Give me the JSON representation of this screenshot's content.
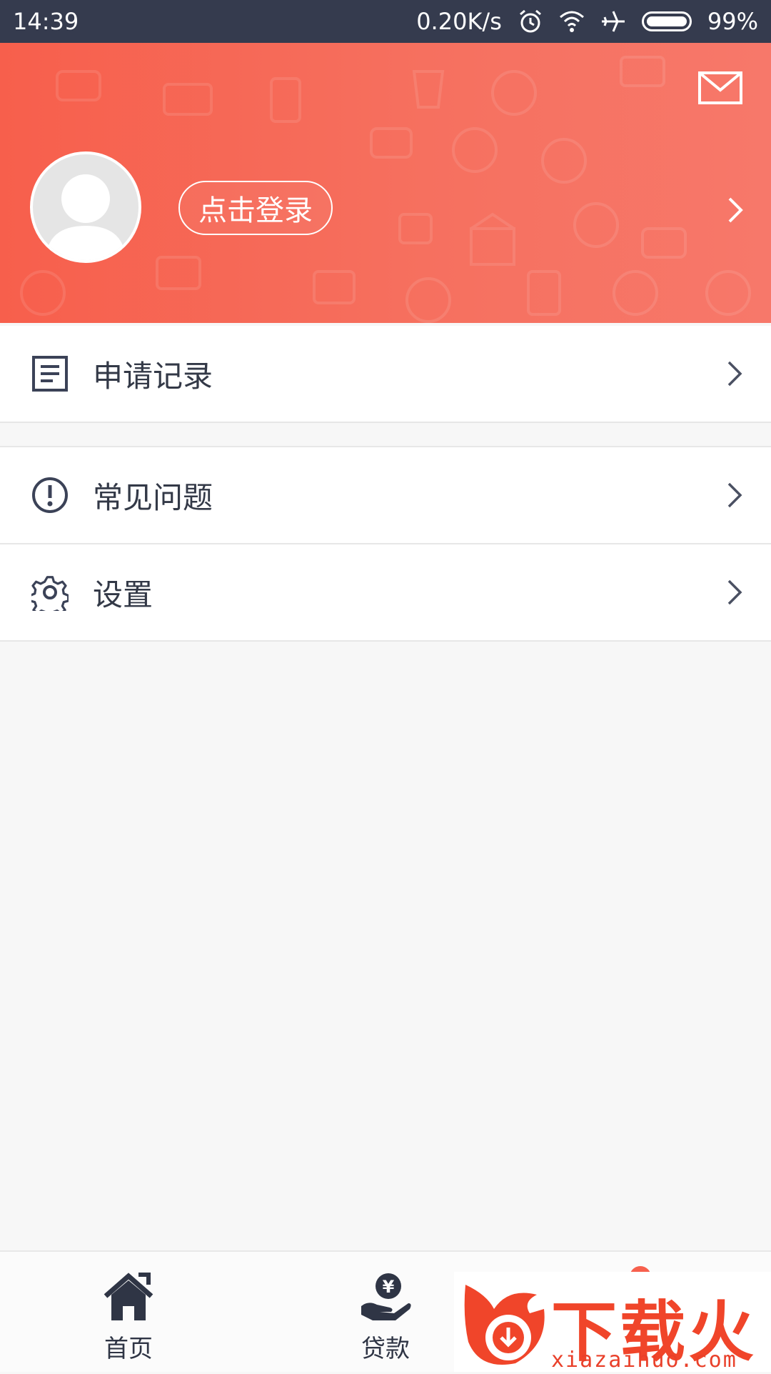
{
  "status_bar": {
    "time": "14:39",
    "net_speed": "0.20K/s",
    "battery": "99%",
    "icons": [
      "alarm-icon",
      "wifi-icon",
      "airplane-icon",
      "battery-icon"
    ]
  },
  "header": {
    "login_label": "点击登录",
    "icons": [
      "mail-icon",
      "avatar",
      "chevron-right-icon"
    ],
    "gradient": [
      "#f75f4c",
      "#f7786a"
    ]
  },
  "menu": [
    {
      "label": "申请记录",
      "icon": "document-list-icon"
    },
    {
      "label": "常见问题",
      "icon": "exclamation-circle-icon"
    },
    {
      "label": "设置",
      "icon": "gear-icon"
    }
  ],
  "bottom_nav": [
    {
      "label": "首页",
      "icon": "home-icon"
    },
    {
      "label": "贷款",
      "icon": "loan-hand-yuan-icon"
    }
  ],
  "watermark": {
    "title": "下载火",
    "url": "xiazaihuo.com"
  },
  "colors": {
    "accent": "#f7604d",
    "status_bar": "#353b4e",
    "text": "#333947"
  }
}
